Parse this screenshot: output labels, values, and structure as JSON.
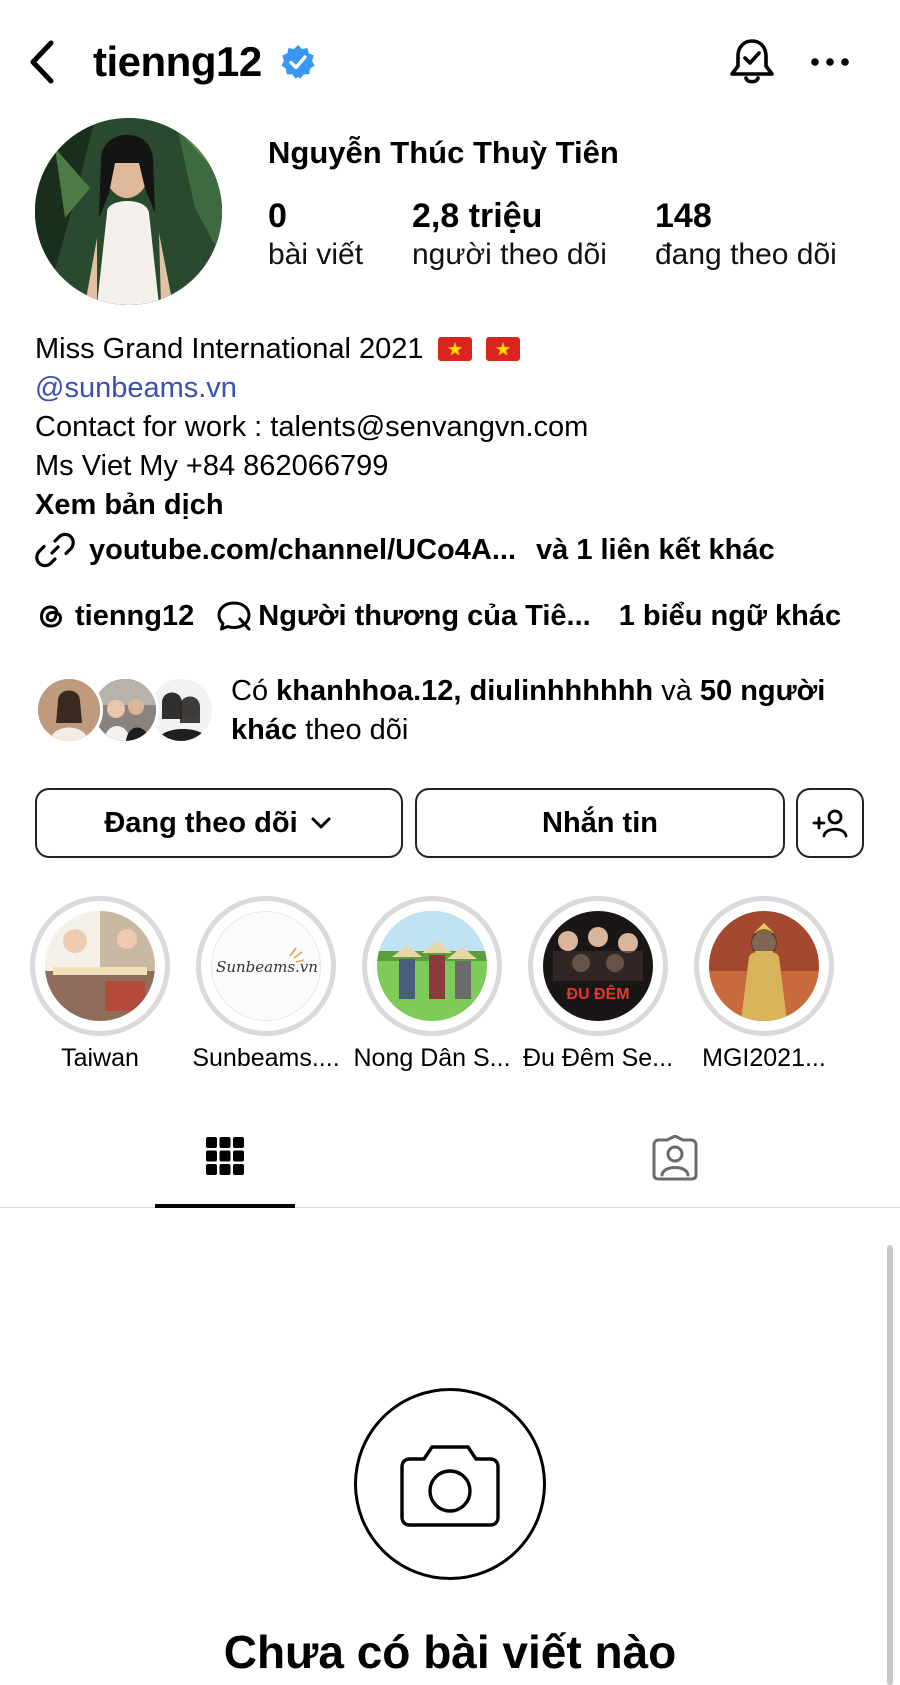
{
  "header": {
    "username": "tienng12",
    "verified": true,
    "accent": "#3897f0"
  },
  "profile": {
    "full_name": "Nguyễn Thúc Thuỳ Tiên",
    "stats": [
      {
        "value": "0",
        "label": "bài viết"
      },
      {
        "value": "2,8 triệu",
        "label": "người theo dõi"
      },
      {
        "value": "148",
        "label": "đang theo dõi"
      }
    ]
  },
  "bio": {
    "line1": "Miss Grand International 2021",
    "mention": "@sunbeams.vn",
    "line3": "Contact for work : talents@senvangvn.com",
    "line4": "Ms Viet My +84 862066799",
    "translate": "Xem bản dịch"
  },
  "links": {
    "url": "youtube.com/channel/UCo4A...",
    "more": "và 1 liên kết khác"
  },
  "threads": {
    "handle": "tienng12",
    "badge": "Người thương của Tiê...",
    "more": "1 biểu ngữ khác"
  },
  "followed_by": {
    "prefix": "Có",
    "user1": "khanhhoa.12,",
    "user2": "diulinhhhhhh",
    "and": "và",
    "count": "50 người",
    "others": "khác",
    "suffix": "theo dõi"
  },
  "actions": {
    "following": "Đang theo dõi",
    "message": "Nhắn tin"
  },
  "highlights": [
    {
      "label": "Taiwan"
    },
    {
      "label": "Sunbeams...."
    },
    {
      "label": "Nong Dân S..."
    },
    {
      "label": "Đu Đêm Se..."
    },
    {
      "label": "MGI2021..."
    }
  ],
  "highlight_inner": {
    "sunbeams_logo": "Sunbeams.vn",
    "dudem_text": "ĐU ĐÊM"
  },
  "empty_state": {
    "title": "Chưa có bài viết nào"
  }
}
